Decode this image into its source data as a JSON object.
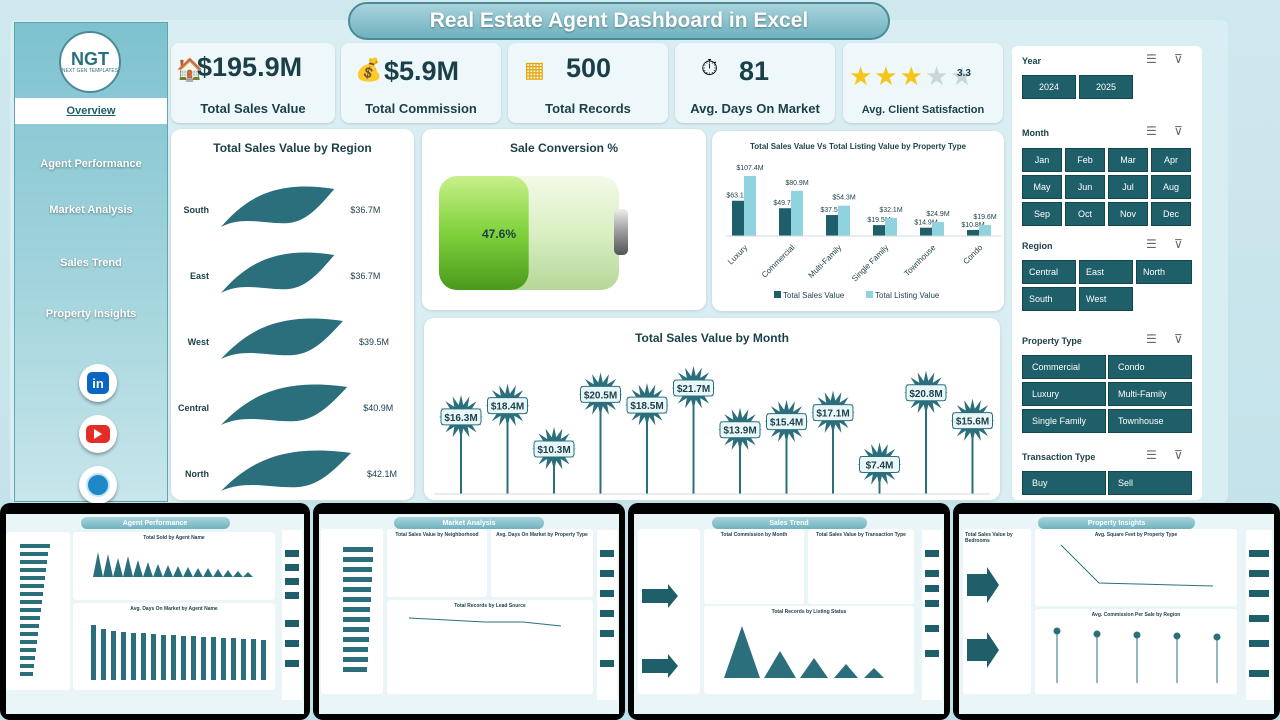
{
  "title": "Real Estate Agent Dashboard in Excel",
  "logo": {
    "text": "NGT",
    "subtext": "NEXT GEN TEMPLATES"
  },
  "nav": [
    "Overview",
    "Agent Performance",
    "Market Analysis",
    "Sales Trend",
    "Property Insights"
  ],
  "social": [
    "linkedin-icon",
    "youtube-icon",
    "website-icon"
  ],
  "kpis": {
    "sales": {
      "value": "$195.9M",
      "label": "Total Sales Value"
    },
    "commission": {
      "value": "$5.9M",
      "label": "Total Commission"
    },
    "records": {
      "value": "500",
      "label": "Total Records"
    },
    "days": {
      "value": "81",
      "label": "Avg. Days On Market"
    },
    "satisfaction": {
      "value": "3.3",
      "label": "Avg. Client Satisfaction",
      "stars_filled": 3,
      "stars_total": 5
    }
  },
  "panels": {
    "region": "Total Sales Value by Region",
    "conversion": "Sale Conversion %",
    "property": "Total Sales Value Vs Total Listing Value by Property Type",
    "month": "Total Sales Value by Month"
  },
  "conversion_value": "47.6%",
  "conversion_fraction": 0.476,
  "chart_data": [
    {
      "type": "bar",
      "title": "Total Sales Value by Region",
      "categories": [
        "South",
        "East",
        "West",
        "Central",
        "North"
      ],
      "values": [
        36.7,
        36.7,
        39.5,
        40.9,
        42.1
      ],
      "labels": [
        "$36.7M",
        "$36.7M",
        "$39.5M",
        "$40.9M",
        "$42.1M"
      ]
    },
    {
      "type": "bar",
      "title": "Total Sales Value Vs Total Listing Value by Property Type",
      "categories": [
        "Luxury",
        "Commercial",
        "Multi-Family",
        "Single Family",
        "Townhouse",
        "Condo"
      ],
      "series": [
        {
          "name": "Total Sales Value",
          "values": [
            63.1,
            49.7,
            37.5,
            19.5,
            14.9,
            10.8
          ],
          "labels": [
            "$63.1M",
            "$49.7M",
            "$37.5M",
            "$19.5M",
            "$14.9M",
            "$10.8M"
          ]
        },
        {
          "name": "Total Listing Value",
          "values": [
            107.4,
            80.9,
            54.3,
            32.1,
            24.9,
            19.6
          ],
          "labels": [
            "$107.4M",
            "$80.9M",
            "$54.3M",
            "$32.1M",
            "$24.9M",
            "$19.6M"
          ]
        }
      ]
    },
    {
      "type": "line",
      "title": "Total Sales Value by Month",
      "values": [
        16.3,
        18.4,
        10.3,
        20.5,
        18.5,
        21.7,
        13.9,
        15.4,
        17.1,
        7.4,
        20.8,
        15.6
      ],
      "labels": [
        "$16.3M",
        "$18.4M",
        "$10.3M",
        "$20.5M",
        "$18.5M",
        "$21.7M",
        "$13.9M",
        "$15.4M",
        "$17.1M",
        "$7.4M",
        "$20.8M",
        "$15.6M"
      ]
    }
  ],
  "filters": {
    "year": {
      "label": "Year",
      "options": [
        "2024",
        "2025"
      ]
    },
    "month": {
      "label": "Month",
      "options": [
        "Jan",
        "Feb",
        "Mar",
        "Apr",
        "May",
        "Jun",
        "Jul",
        "Aug",
        "Sep",
        "Oct",
        "Nov",
        "Dec"
      ]
    },
    "region": {
      "label": "Region",
      "options": [
        "Central",
        "East",
        "North",
        "South",
        "West"
      ]
    },
    "property": {
      "label": "Property Type",
      "options": [
        "Commercial",
        "Condo",
        "Luxury",
        "Multi-Family",
        "Single Family",
        "Townhouse"
      ]
    },
    "transaction": {
      "label": "Transaction Type",
      "options": [
        "Buy",
        "Sell"
      ]
    }
  },
  "thumbnails": {
    "agent": {
      "title": "Agent Performance",
      "c1": "Total Sold by Agent Name",
      "c2": "Avg. Days On Market by Agent Name"
    },
    "market": {
      "title": "Market Analysis",
      "c1": "Total Sales Value by Neighborhood",
      "c2": "Avg. Days On Market by Property Type",
      "c3": "Total Records by Lead Source"
    },
    "trend": {
      "title": "Sales Trend",
      "c1": "Total Commission by Month",
      "c2": "Total Sales Value by Transaction Type",
      "c3": "Total Records by Listing Status"
    },
    "insights": {
      "title": "Property Insights",
      "c1": "Total Sales Value by Bedrooms",
      "c2": "Avg. Square Feet by Property Type",
      "c3": "Avg. Commission Per Sale by Region"
    }
  },
  "colors": {
    "dark_teal": "#2b6f7c",
    "light_teal": "#8fd3de",
    "chip": "#1f5f6a",
    "battery_green": "#7fd13b"
  }
}
